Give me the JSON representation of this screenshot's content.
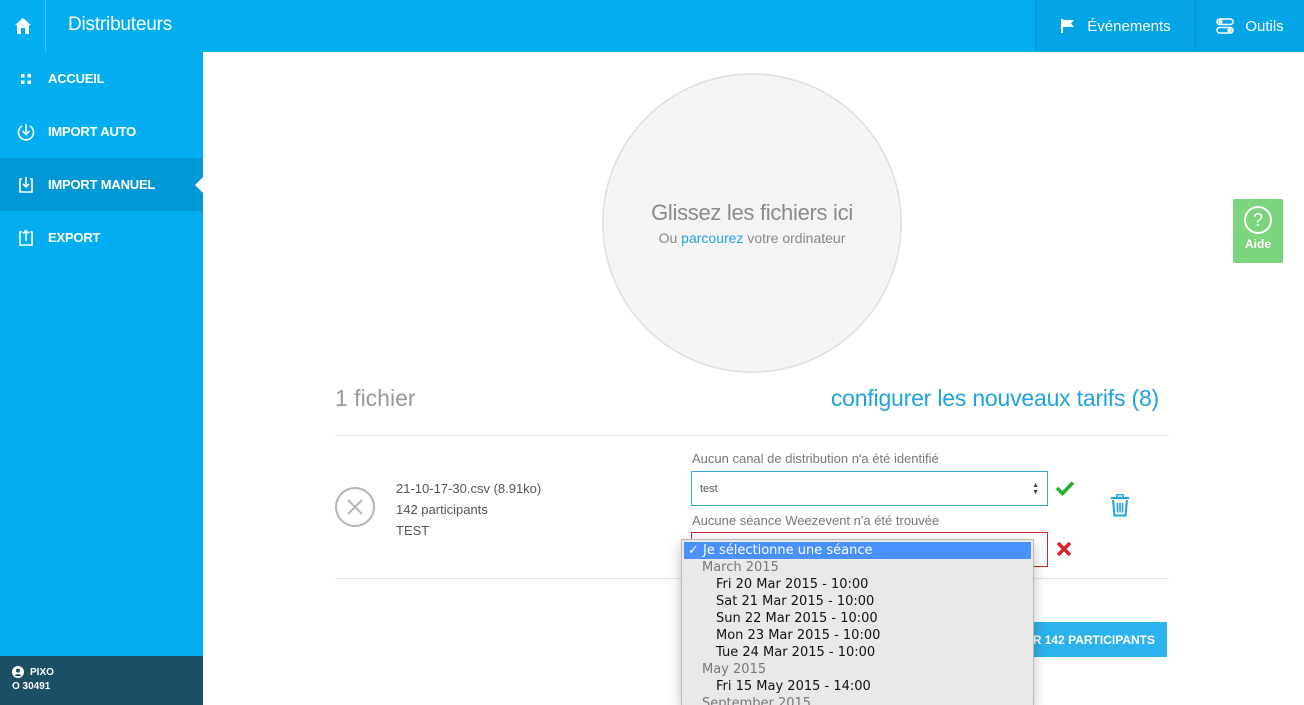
{
  "header": {
    "title": "Distributeurs",
    "nav": [
      {
        "label": "Événements",
        "icon": "flag-icon"
      },
      {
        "label": "Outils",
        "icon": "toggles-icon"
      }
    ]
  },
  "sidebar": {
    "items": [
      {
        "label": "ACCUEIL",
        "icon": "grid-icon"
      },
      {
        "label": "IMPORT AUTO",
        "icon": "download-circle-icon"
      },
      {
        "label": "IMPORT MANUEL",
        "icon": "import-icon",
        "active": true
      },
      {
        "label": "EXPORT",
        "icon": "export-icon"
      }
    ],
    "user": {
      "name": "PIXO",
      "id": "O 30491"
    }
  },
  "dropzone": {
    "title": "Glissez les fichiers ici",
    "sub_prefix": "Ou",
    "sub_link": "parcourez",
    "sub_suffix": "votre ordinateur"
  },
  "files": {
    "count_label": "1 fichier",
    "config_link": "configurer les nouveaux tarifs (8)",
    "items": [
      {
        "filename": "21-10-17-30.csv (8.91ko)",
        "participants": "142 participants",
        "name": "TEST",
        "canal_label": "Aucun canal de distribution n'a été identifié",
        "canal_value": "test",
        "seance_label": "Aucune séance Weezevent n'a été trouvée"
      }
    ]
  },
  "import_button": "R 142 PARTICIPANTS",
  "dropdown": {
    "selected": "✓ Je sélectionne une séance",
    "groups": [
      {
        "label": "March 2015",
        "options": [
          "Fri 20 Mar 2015 - 10:00",
          "Sat 21 Mar 2015 - 10:00",
          "Sun 22 Mar 2015 - 10:00",
          "Mon 23 Mar 2015 - 10:00",
          "Tue 24 Mar 2015 - 10:00"
        ]
      },
      {
        "label": "May 2015",
        "options": [
          "Fri 15 May 2015 - 14:00"
        ]
      },
      {
        "label": "September 2015",
        "options": []
      }
    ]
  },
  "help": {
    "label": "Aide"
  },
  "colors": {
    "brand": "#02aef0",
    "success": "#22b02a",
    "error": "#d9242a",
    "help": "#7cd47c"
  }
}
